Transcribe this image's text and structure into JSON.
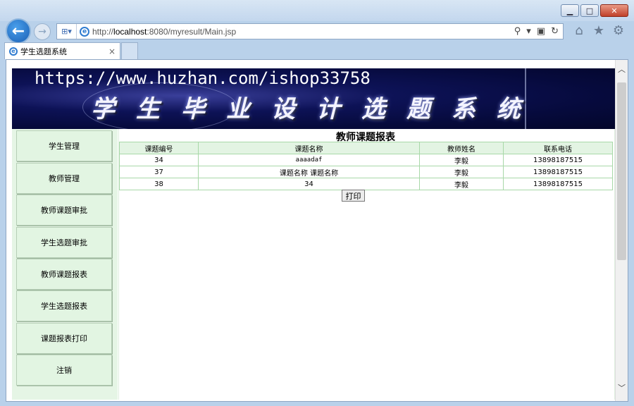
{
  "browser": {
    "url_prefix": "http://",
    "url_host": "localhost",
    "url_rest": ":8080/myresult/Main.jsp",
    "tab_title": "学生选题系统",
    "tab_close": "×"
  },
  "banner": {
    "watermark": "https://www.huzhan.com/ishop33758",
    "title": "学生毕业设计选题系统"
  },
  "sidebar": {
    "items": [
      {
        "label": "学生管理"
      },
      {
        "label": "教师管理"
      },
      {
        "label": "教师课题审批"
      },
      {
        "label": "学生选题审批"
      },
      {
        "label": "教师课题报表"
      },
      {
        "label": "学生选题报表"
      },
      {
        "label": "课题报表打印"
      },
      {
        "label": "注销"
      }
    ]
  },
  "report": {
    "title": "教师课题报表",
    "columns": [
      "课题编号",
      "课题名称",
      "教师姓名",
      "联系电话"
    ],
    "rows": [
      [
        "34",
        "aaaadaf",
        "李毅",
        "13898187515"
      ],
      [
        "37",
        "课题名称 课题名称",
        "李毅",
        "13898187515"
      ],
      [
        "38",
        "34",
        "李毅",
        "13898187515"
      ]
    ],
    "print_label": "打印"
  },
  "colors": {
    "banner_bg": "#060a3c",
    "menu_bg": "#e2f5e2",
    "table_border": "#a8d8a8"
  }
}
